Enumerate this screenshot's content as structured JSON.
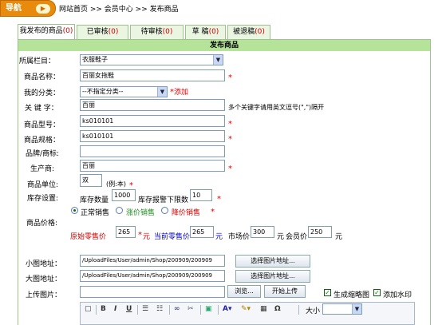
{
  "nav": {
    "button": "导航",
    "breadcrumb": "网站首页 >> 会员中心 >> 发布商品"
  },
  "tabs": [
    {
      "label": "我发布的商品",
      "count": "(0)"
    },
    {
      "label": "已审核",
      "count": "(0)"
    },
    {
      "label": "待审核",
      "count": "(0)"
    },
    {
      "label": "草 稿",
      "count": "(0)"
    },
    {
      "label": "被退稿",
      "count": "(0)"
    }
  ],
  "panel_title": "发布商品",
  "form": {
    "category_label": "所属栏目：",
    "category_value": "衣服鞋子",
    "name_label": "商品名称：",
    "name_value": "百丽女拖鞋",
    "mycat_label": "我的分类：",
    "mycat_value": "--不指定分类--",
    "mycat_add": "添加",
    "keyword_label": "关 键 字：",
    "keyword_value": "百丽",
    "keyword_hint": "多个关键字请用英文逗号(\",\")隔开",
    "model_label": "商品型号：",
    "model_value": "ks010101",
    "spec_label": "商品规格：",
    "spec_value": "ks010101",
    "brand_label": "品牌/商标:",
    "brand_value": "",
    "maker_label": "生产商:",
    "maker_value": "百丽",
    "unit_label": "商品单位:",
    "unit_value": "双",
    "unit_hint": "(例:本)",
    "stock_label": "库存设置:",
    "stock_qty_label": "库存数量",
    "stock_qty": "1000",
    "stock_alarm_label": "库存报警下限数",
    "stock_alarm": "10",
    "price_label": "商品价格:",
    "sale_options": [
      "正常销售",
      "涨价销售",
      "降价销售"
    ],
    "orig_price_label": "原始零售价",
    "orig_price": "265",
    "orig_price_unit": "元",
    "cur_price_label": "当前零售价",
    "cur_price": "265",
    "cur_price_unit": "元",
    "market_label": "市场价",
    "market_price": "300",
    "market_unit": "元",
    "member_label": "会员价",
    "member_price": "250",
    "member_unit": "元",
    "small_img_label": "小图地址：",
    "small_img_value": "/UploadFiles/User/admin/Shop/200909/200909",
    "big_img_label": "大图地址：",
    "big_img_value": "/UploadFiles/User/admin/Shop/200909/200909",
    "choose_img_btn": "选择图片地址...",
    "upload_label": "上传图片：",
    "browse_btn": "浏览...",
    "upload_btn": "开始上传",
    "thumb_label": "生成缩略图",
    "watermark_label": "添加水印",
    "editor_size_label": "大小"
  },
  "colors": {
    "accent": "#e88a0c",
    "tab_border": "#9cc389",
    "panel_head": "#b5e39a",
    "required": "#e00000",
    "blue_link": "#0000cc"
  }
}
